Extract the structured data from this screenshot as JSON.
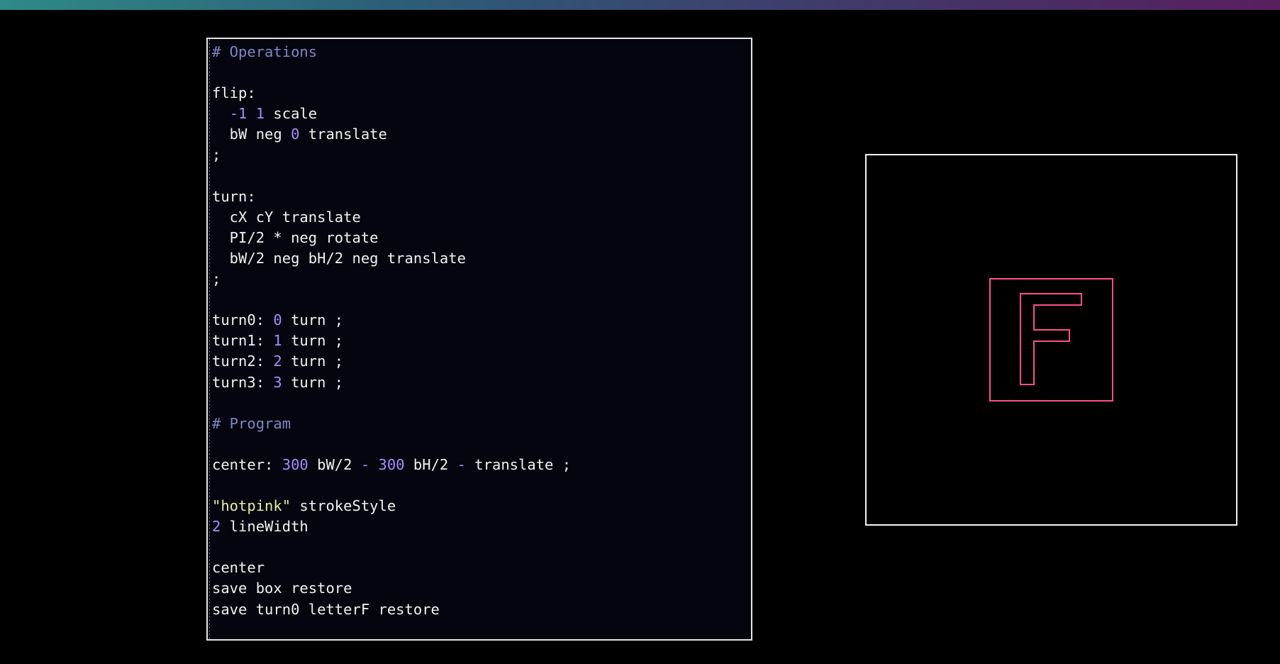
{
  "colors": {
    "comment": "#7d86c8",
    "number": "#a98bff",
    "string": "#e6eea0",
    "text": "#f2f2f2",
    "stroke": "hotpink"
  },
  "editor": {
    "lines": [
      [
        {
          "t": "# Operations",
          "k": "comment"
        }
      ],
      [],
      [
        {
          "t": "flip:",
          "k": "plain"
        }
      ],
      [
        {
          "t": "  ",
          "k": "plain"
        },
        {
          "t": "-1",
          "k": "num"
        },
        {
          "t": " ",
          "k": "plain"
        },
        {
          "t": "1",
          "k": "num"
        },
        {
          "t": " scale",
          "k": "plain"
        }
      ],
      [
        {
          "t": "  bW neg ",
          "k": "plain"
        },
        {
          "t": "0",
          "k": "num"
        },
        {
          "t": " translate",
          "k": "plain"
        }
      ],
      [
        {
          "t": ";",
          "k": "plain"
        }
      ],
      [],
      [
        {
          "t": "turn:",
          "k": "plain"
        }
      ],
      [
        {
          "t": "  cX cY translate",
          "k": "plain"
        }
      ],
      [
        {
          "t": "  PI/2 * neg rotate",
          "k": "plain"
        }
      ],
      [
        {
          "t": "  bW/2 neg bH/2 neg translate",
          "k": "plain"
        }
      ],
      [
        {
          "t": ";",
          "k": "plain"
        }
      ],
      [],
      [
        {
          "t": "turn0: ",
          "k": "plain"
        },
        {
          "t": "0",
          "k": "num"
        },
        {
          "t": " turn ;",
          "k": "plain"
        }
      ],
      [
        {
          "t": "turn1: ",
          "k": "plain"
        },
        {
          "t": "1",
          "k": "num"
        },
        {
          "t": " turn ;",
          "k": "plain"
        }
      ],
      [
        {
          "t": "turn2: ",
          "k": "plain"
        },
        {
          "t": "2",
          "k": "num"
        },
        {
          "t": " turn ;",
          "k": "plain"
        }
      ],
      [
        {
          "t": "turn3: ",
          "k": "plain"
        },
        {
          "t": "3",
          "k": "num"
        },
        {
          "t": " turn ;",
          "k": "plain"
        }
      ],
      [],
      [
        {
          "t": "# Program",
          "k": "comment"
        }
      ],
      [],
      [
        {
          "t": "center: ",
          "k": "plain"
        },
        {
          "t": "300",
          "k": "num"
        },
        {
          "t": " bW/2 ",
          "k": "plain"
        },
        {
          "t": "-",
          "k": "op"
        },
        {
          "t": " ",
          "k": "plain"
        },
        {
          "t": "300",
          "k": "num"
        },
        {
          "t": " bH/2 ",
          "k": "plain"
        },
        {
          "t": "-",
          "k": "op"
        },
        {
          "t": " translate ;",
          "k": "plain"
        }
      ],
      [],
      [
        {
          "t": "\"hotpink\"",
          "k": "str"
        },
        {
          "t": " strokeStyle",
          "k": "plain"
        }
      ],
      [
        {
          "t": "2",
          "k": "num"
        },
        {
          "t": " lineWidth",
          "k": "plain"
        }
      ],
      [],
      [
        {
          "t": "center",
          "k": "plain"
        }
      ],
      [
        {
          "t": "save box restore",
          "k": "plain"
        }
      ],
      [
        {
          "t": "save turn0 letterF restore",
          "k": "plain"
        }
      ]
    ]
  },
  "canvas": {
    "stroke_style": "hotpink",
    "line_width": 2
  }
}
